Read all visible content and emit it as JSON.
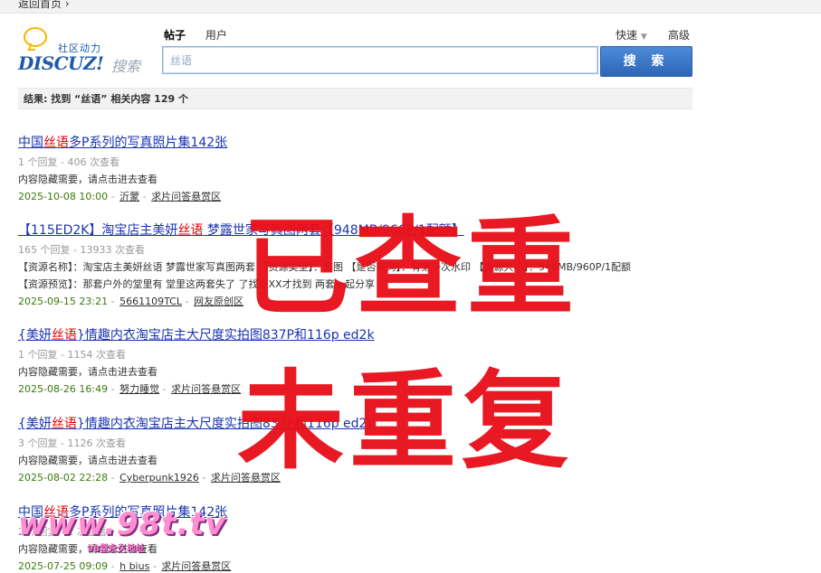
{
  "topbar": {
    "back_label": "返回首页 ›"
  },
  "logo": {
    "slogan": "社区动力",
    "brand": "DISCUZ!",
    "brand_sub": "搜索"
  },
  "search": {
    "tabs": [
      "帖子",
      "用户"
    ],
    "quick": "快速",
    "advanced": "高级",
    "query": "丝语",
    "button": "搜 索"
  },
  "result_summary": "结果: 找到 “丝语” 相关内容 129 个",
  "results": [
    {
      "title_pre": "中国",
      "title_hl": "丝语",
      "title_post": "多P系列的写真照片集142张",
      "meta": "1 个回复 - 406 次查看",
      "content1": "内容隐藏需要，请点击进去查看",
      "content2": "",
      "date": "2025-10-08 10:00",
      "author": "沂蒙",
      "forum": "求片问答悬赏区"
    },
    {
      "title_pre": "【115ED2K】淘宝店主美妍",
      "title_hl": "丝语",
      "title_post": " 梦露世家写真图两套【948MB/960P/1配额】",
      "meta": "165 个回复 - 13933 次查看",
      "content1": "【资源名称】：淘宝店主美妍丝语 梦露世家写真图两套 【资源类型】：套图 【是否有码】：有第一次水印 【资源大小】：948MB/960P/1配额",
      "content2": "【资源预览】：那套户外的堂里有 堂里这两套失了 了找遍XX才找到 两套一起分享 …",
      "date": "2025-09-15 23:21",
      "author": "5661109TCL",
      "forum": "网友原创区"
    },
    {
      "title_pre": "{美妍",
      "title_hl": "丝语",
      "title_post": "}情趣内衣淘宝店主大尺度实拍图837P和116p ed2k",
      "meta": "1 个回复 - 1154 次查看",
      "content1": "内容隐藏需要，请点击进去查看",
      "content2": "",
      "date": "2025-08-26 16:49",
      "author": "努力睡觉",
      "forum": "求片问答悬赏区"
    },
    {
      "title_pre": "{美妍",
      "title_hl": "丝语",
      "title_post": "}情趣内衣淘宝店主大尺度实拍图837P和116p ed2k",
      "meta": "3 个回复 - 1126 次查看",
      "content1": "内容隐藏需要，请点击进去查看",
      "content2": "",
      "date": "2025-08-02 22:28",
      "author": "Cyberpunk1926",
      "forum": "求片问答悬赏区"
    },
    {
      "title_pre": "中国",
      "title_hl": "丝语",
      "title_post": "多P系列的写真照片集142张",
      "meta": "2 个回复 - 1 次查看",
      "content1": "内容隐藏需要，请点击进去查看",
      "content2": "",
      "date": "2025-07-25 09:09",
      "author": "h bius",
      "forum": "求片问答悬赏区"
    }
  ],
  "overlay": {
    "stamp1": "已查重",
    "stamp2": "未重复"
  },
  "watermark": {
    "url": "www.98t.tv",
    "sub": "98堂永久地址"
  }
}
